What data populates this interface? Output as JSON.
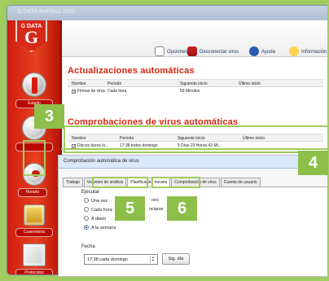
{
  "window": {
    "title": "G DATA AntiVirus 2011"
  },
  "sidebar": {
    "logo_top": "G DATA",
    "logo_letter": "G",
    "items": [
      {
        "label": "Estado"
      },
      {
        "label": ""
      },
      {
        "label": "Horario"
      },
      {
        "label": "Cuarentena"
      },
      {
        "label": "Protocolos"
      }
    ]
  },
  "toolbar": {
    "items": [
      {
        "label": "Opciones",
        "icon": "options-icon"
      },
      {
        "label": "Desconectar virus",
        "icon": "disconnect-virus-icon"
      },
      {
        "label": "Ayuda",
        "icon": "help-icon"
      },
      {
        "label": "Información",
        "icon": "info-icon"
      }
    ]
  },
  "updates": {
    "title": "Actualizaciones automáticas",
    "columns": [
      "Nombre",
      "Periodo",
      "Siguiente inicio",
      "Último inicio"
    ],
    "rows": [
      {
        "name": "Firmas de virus",
        "period": "Cada hora",
        "next_start": "59 Minutos",
        "last_start": ""
      }
    ]
  },
  "virus_checks": {
    "title": "Comprobaciones de virus automáticas",
    "columns": [
      "Nombre",
      "Periodo",
      "Siguiente inicio",
      "Último inicio"
    ],
    "rows": [
      {
        "name": "Discos duros lo...",
        "period": "17:38 todos domingo",
        "next_start": "5 Días 23 Horas 43 Mi...",
        "last_start": ""
      }
    ]
  },
  "dialog": {
    "title": "Comprobación automática de virus",
    "tabs": [
      "Trabajo",
      "Volumen de análisis",
      "Planificación horaria",
      "Comprobación de virus",
      "Cuenta de usuario"
    ],
    "execute_label": "Ejecutar",
    "radios": [
      {
        "label": "Una vez",
        "selected": false
      },
      {
        "label": "Cada hora",
        "selected": false
      },
      {
        "label": "A diario",
        "selected": false
      },
      {
        "label": "A la semana",
        "selected": true
      }
    ],
    "partial_radio_texts": [
      "nes",
      "nciarse"
    ],
    "date_label": "Fecha",
    "date_value": "17:38 cada domingo",
    "next_button": "Sig. día"
  },
  "callouts": {
    "badge_3": "3",
    "badge_4": "4",
    "badge_5": "5",
    "badge_6": "6"
  },
  "colors": {
    "accent_green": "#9fcc5f",
    "brand_red": "#d52919",
    "section_red": "#d6250e"
  }
}
